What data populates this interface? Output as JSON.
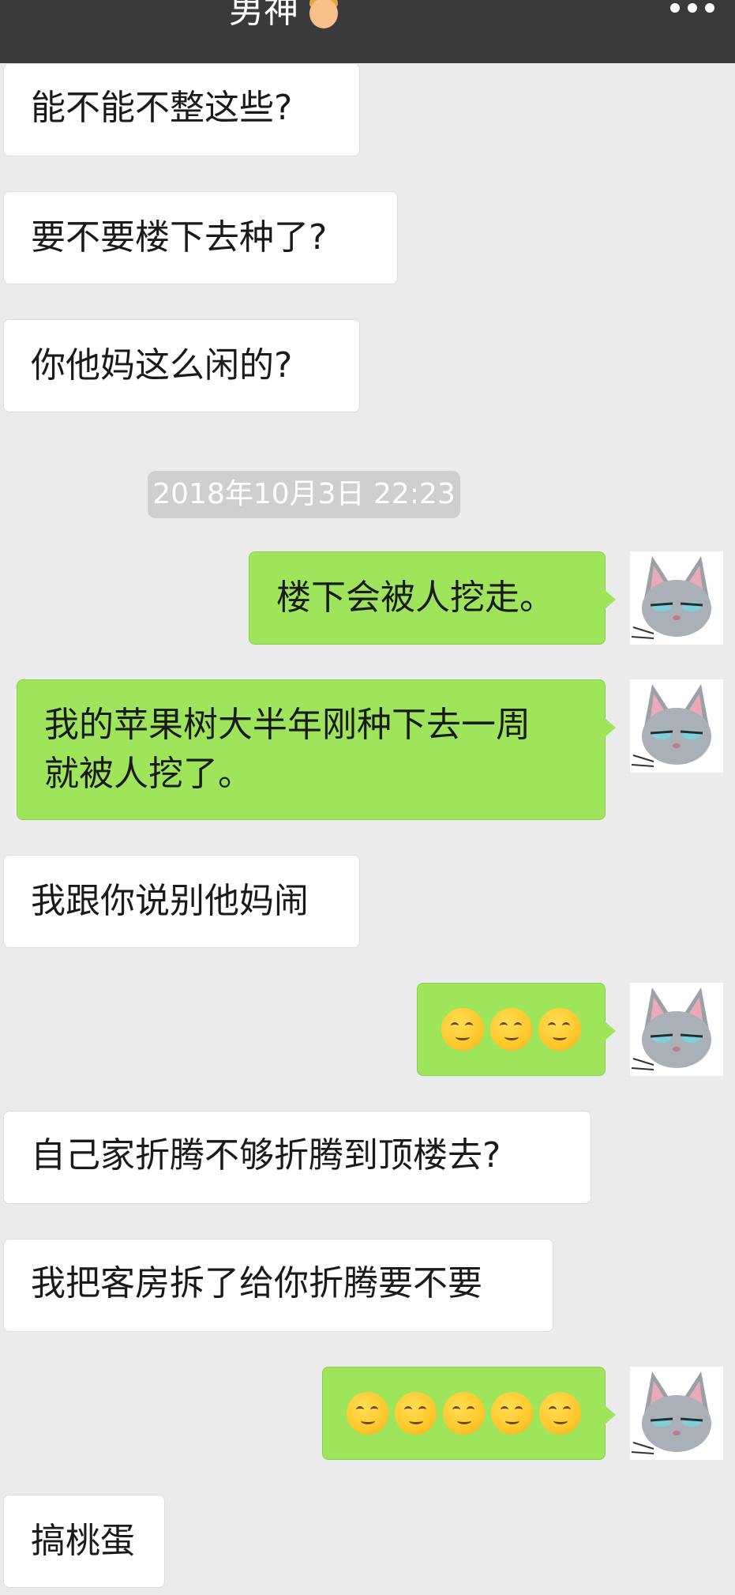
{
  "header": {
    "title": "男神",
    "title_emoji": "man-face-emoji",
    "more_icon": "more-dots-icon"
  },
  "timestamp": "2018年10月3日 22:23",
  "messages": [
    {
      "side": "in",
      "text": "能不能不整这些?"
    },
    {
      "side": "in",
      "text": "要不要楼下去种了?"
    },
    {
      "side": "in",
      "text": "你他妈这么闲的?"
    },
    {
      "side": "out",
      "text": "楼下会被人挖走。"
    },
    {
      "side": "out",
      "text": "我的苹果树大半年刚种下去一周\n就被人挖了。"
    },
    {
      "side": "in",
      "text": "我跟你说别他妈闹"
    },
    {
      "side": "out",
      "emoji_count": 3,
      "emoji": "relieved-face-emoji"
    },
    {
      "side": "in",
      "text": "自己家折腾不够折腾到顶楼去?"
    },
    {
      "side": "in",
      "text": "我把客房拆了给你折腾要不要"
    },
    {
      "side": "out",
      "emoji_count": 5,
      "emoji": "relieved-face-emoji"
    },
    {
      "side": "in",
      "text": "搞桃蛋"
    }
  ],
  "avatar_icon": "gray-cat-avatar-icon"
}
